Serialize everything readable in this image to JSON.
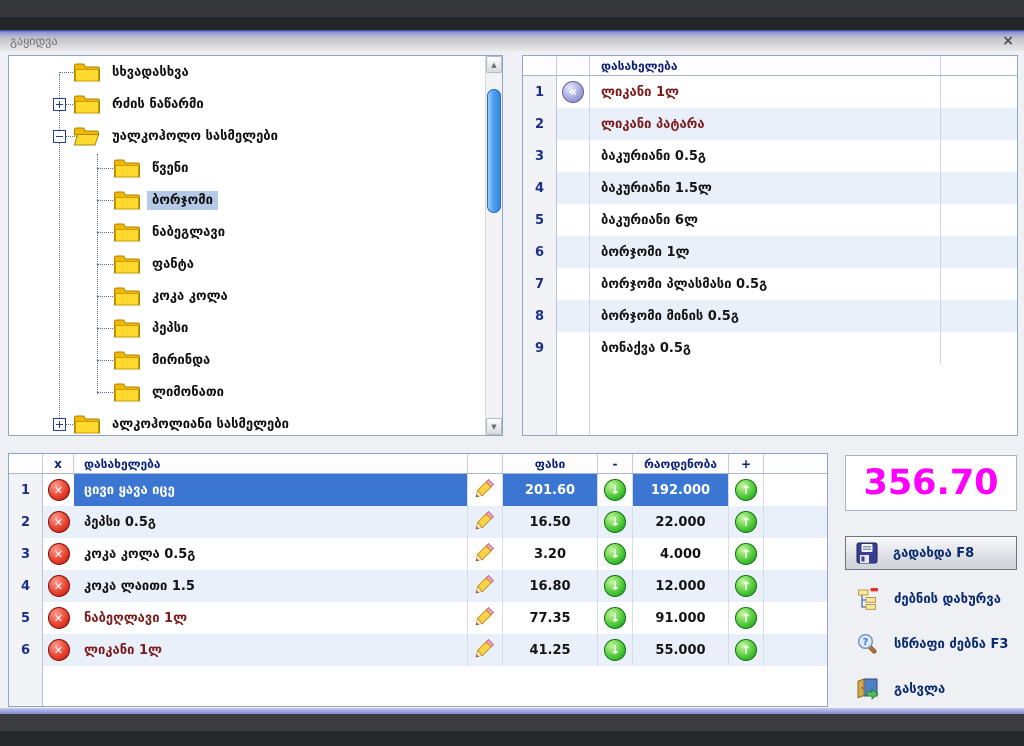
{
  "window": {
    "title": "გაყიდვა",
    "close_label": "×"
  },
  "tree": {
    "items": [
      {
        "label": "სხვადასხვა",
        "level": 0,
        "expander": "none",
        "selected": false
      },
      {
        "label": "რძის ნაწარმი",
        "level": 0,
        "expander": "plus",
        "selected": false
      },
      {
        "label": "უალკოჰოლო სასმელები",
        "level": 0,
        "expander": "minus",
        "selected": false
      },
      {
        "label": "წვენი",
        "level": 1,
        "expander": "none",
        "selected": false
      },
      {
        "label": "ბორჯომი",
        "level": 1,
        "expander": "none",
        "selected": true
      },
      {
        "label": "ნაბეგლავი",
        "level": 1,
        "expander": "none",
        "selected": false
      },
      {
        "label": "ფანტა",
        "level": 1,
        "expander": "none",
        "selected": false
      },
      {
        "label": "კოკა კოლა",
        "level": 1,
        "expander": "none",
        "selected": false
      },
      {
        "label": "პეპსი",
        "level": 1,
        "expander": "none",
        "selected": false
      },
      {
        "label": "მირინდა",
        "level": 1,
        "expander": "none",
        "selected": false
      },
      {
        "label": "ლიმონათი",
        "level": 1,
        "expander": "none",
        "selected": false
      },
      {
        "label": "ალკოჰოლიანი სასმელები",
        "level": 0,
        "expander": "plus",
        "selected": false
      }
    ],
    "scrollbar": {
      "up_icon": "▲",
      "down_icon": "▼"
    }
  },
  "products": {
    "header": "დასახელება",
    "rows": [
      {
        "num": "1",
        "name": "ლიკანი 1ლ",
        "icon": "back-arrow",
        "dark_red": true
      },
      {
        "num": "2",
        "name": "ლიკანი პატარა",
        "icon": "",
        "dark_red": true
      },
      {
        "num": "3",
        "name": "ბაკურიანი 0.5გ",
        "icon": "",
        "dark_red": false
      },
      {
        "num": "4",
        "name": "ბაკურიანი 1.5ლ",
        "icon": "",
        "dark_red": false
      },
      {
        "num": "5",
        "name": "ბაკურიანი 6ლ",
        "icon": "",
        "dark_red": false
      },
      {
        "num": "6",
        "name": "ბორჯომი 1ლ",
        "icon": "",
        "dark_red": false
      },
      {
        "num": "7",
        "name": "ბორჯომი პლასმასი 0.5გ",
        "icon": "",
        "dark_red": false
      },
      {
        "num": "8",
        "name": "ბორჯომი მინის 0.5გ",
        "icon": "",
        "dark_red": false
      },
      {
        "num": "9",
        "name": "ბონაქვა 0.5გ",
        "icon": "",
        "dark_red": false
      }
    ]
  },
  "cart": {
    "headers": {
      "x": "x",
      "name": "დასახელება",
      "price": "ფასი",
      "minus": "-",
      "qty": "რაოდენობა",
      "plus": "+"
    },
    "row_icons": {
      "delete": "delete-icon",
      "edit": "pencil-icon",
      "decrease": "arrow-down-icon",
      "increase": "arrow-up-icon"
    },
    "rows": [
      {
        "num": "1",
        "name": "ცივი ყავა იცე",
        "price": "201.60",
        "qty": "192.000",
        "selected": true,
        "dark_red": false
      },
      {
        "num": "2",
        "name": "პეპსი 0.5გ",
        "price": "16.50",
        "qty": "22.000",
        "selected": false,
        "dark_red": false
      },
      {
        "num": "3",
        "name": "კოკა კოლა 0.5გ",
        "price": "3.20",
        "qty": "4.000",
        "selected": false,
        "dark_red": false
      },
      {
        "num": "4",
        "name": "კოკა ლაითი 1.5",
        "price": "16.80",
        "qty": "12.000",
        "selected": false,
        "dark_red": false
      },
      {
        "num": "5",
        "name": "ნაბეღლავი 1ლ",
        "price": "77.35",
        "qty": "91.000",
        "selected": false,
        "dark_red": true
      },
      {
        "num": "6",
        "name": "ლიკანი 1ლ",
        "price": "41.25",
        "qty": "55.000",
        "selected": false,
        "dark_red": true
      }
    ]
  },
  "summary": {
    "total": "356.70",
    "buttons": [
      {
        "label": "გადახდა F8",
        "icon": "floppy-disk-icon",
        "style": "raised"
      },
      {
        "label": "ძებნის დახურვა",
        "icon": "close-search-icon",
        "style": "flat"
      },
      {
        "label": "სწრაფი ძებნა F3",
        "icon": "quick-search-icon",
        "style": "flat"
      },
      {
        "label": "გასვლა",
        "icon": "exit-door-icon",
        "style": "flat"
      }
    ]
  },
  "colors": {
    "selection_blue": "#3A76D2",
    "row_alt": "#E9F0FA",
    "total_magenta": "#FF00FF",
    "header_navy": "#0A1F78",
    "out_of_stock_maroon": "#7B1D1D",
    "folder_yellow": "#FFD92B"
  }
}
